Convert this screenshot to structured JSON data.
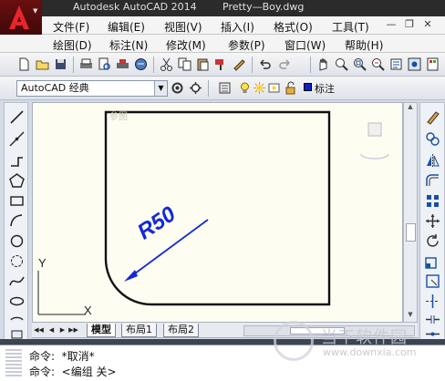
{
  "window": {
    "app_title": "Autodesk AutoCAD 2014",
    "file_name": "Pretty—Boy.dwg",
    "min_label": "—",
    "restore_label": "❐",
    "close_label": "✕"
  },
  "menu_row1": [
    "文件(F)",
    "编辑(E)",
    "视图(V)",
    "插入(I)",
    "格式(O)",
    "工具(T)"
  ],
  "menu_row2": [
    "绘图(D)",
    "标注(N)",
    "修改(M)",
    "参数(P)",
    "窗口(W)",
    "帮助(H)"
  ],
  "workspace": {
    "selected": "AutoCAD 经典",
    "layer_name": "标注"
  },
  "drawing": {
    "dimension_text": "R50",
    "ucs_x_label": "X",
    "ucs_y_label": "Y",
    "stray_text": "参图"
  },
  "tabs": {
    "model": "模型",
    "layout1": "布局1",
    "layout2": "布局2"
  },
  "command": {
    "line1": "命令:  *取消*",
    "line2": "命令:  <编组 关>"
  },
  "watermark": {
    "text": "当下软件园",
    "url": "www.downxia.com"
  },
  "colors": {
    "canvas_bg": "#fefdf2",
    "dimension_blue": "#1428d8",
    "app_red": "#c0191a"
  }
}
